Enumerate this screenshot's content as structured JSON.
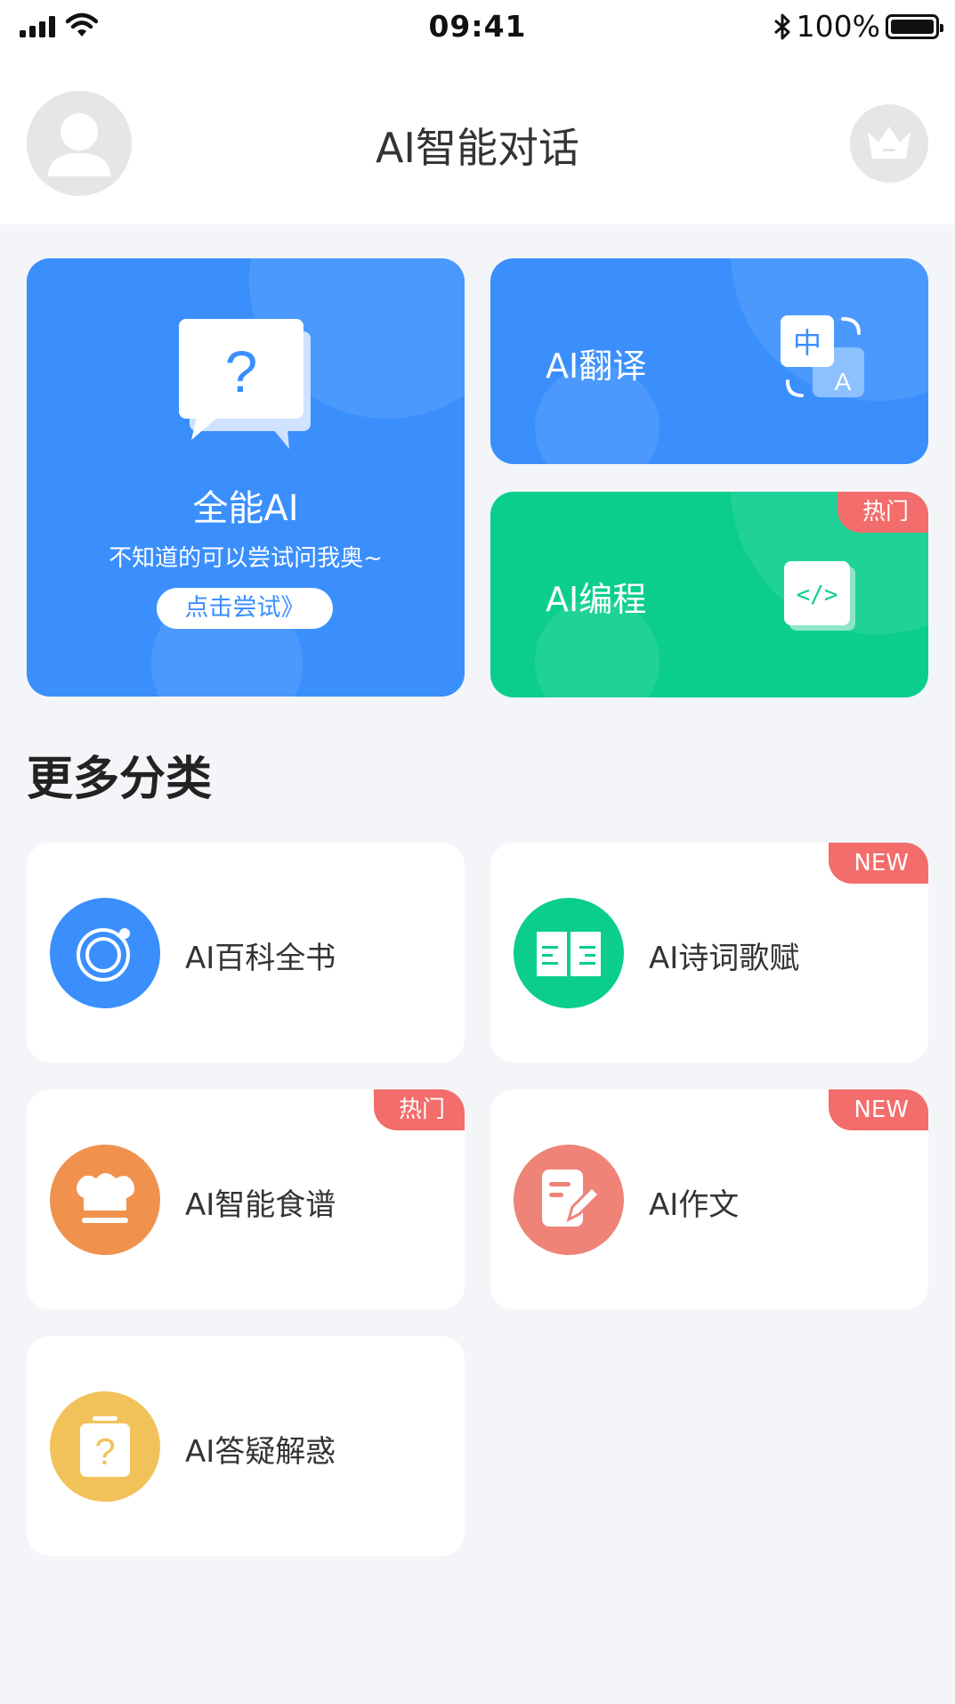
{
  "status_bar": {
    "time": "09:41",
    "battery": "100%"
  },
  "header": {
    "title": "AI智能对话"
  },
  "cards": {
    "all": {
      "title": "全能AI",
      "subtitle": "不知道的可以尝试问我奥~",
      "button": "点击尝试》",
      "icon": "question-bubble-icon"
    },
    "translate": {
      "title": "AI翻译",
      "icon": "translate-icon",
      "icon_text_a": "中",
      "icon_text_b": "A"
    },
    "code": {
      "title": "AI编程",
      "badge": "热门",
      "icon": "code-icon",
      "icon_text": "</>"
    }
  },
  "section": {
    "title": "更多分类"
  },
  "categories": [
    {
      "label": "AI百科全书",
      "badge": "",
      "icon": "orbit-icon",
      "color": "#3a8ffd"
    },
    {
      "label": "AI诗词歌赋",
      "badge": "NEW",
      "icon": "book-icon",
      "color": "#0bce8e"
    },
    {
      "label": "AI智能食谱",
      "badge": "热门",
      "icon": "chef-hat-icon",
      "color": "#f0924e"
    },
    {
      "label": "AI作文",
      "badge": "NEW",
      "icon": "writing-icon",
      "color": "#ef8378"
    },
    {
      "label": "AI答疑解惑",
      "badge": "",
      "icon": "question-clipboard-icon",
      "color": "#f2c25a",
      "icon_text": "?"
    }
  ],
  "colors": {
    "primary": "#3a8ffd",
    "green": "#0bce8e",
    "badge": "#f26d6b",
    "background": "#f4f5f8"
  }
}
